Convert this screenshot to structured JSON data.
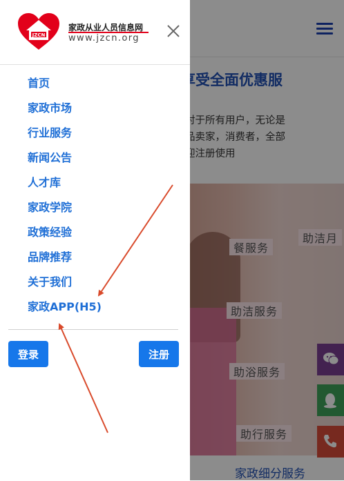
{
  "drawer": {
    "logo_badge": "JZCN",
    "logo_title": "家政从业人员信息网",
    "logo_url": "www.jzcn.org",
    "menu": [
      {
        "label": "首页"
      },
      {
        "label": "家政市场"
      },
      {
        "label": "行业服务"
      },
      {
        "label": "新闻公告"
      },
      {
        "label": "人才库"
      },
      {
        "label": "家政学院"
      },
      {
        "label": "政策经验"
      },
      {
        "label": "品牌推荐"
      },
      {
        "label": "关于我们"
      },
      {
        "label": "家政APP(H5)"
      }
    ],
    "login_label": "登录",
    "register_label": "注册"
  },
  "background": {
    "headline": "享受全面优惠服",
    "paragraph": [
      "对于所有用户，无论是",
      "品卖家，消费者，全部",
      "迎注册使用"
    ],
    "services": [
      "餐服务",
      "助洁月",
      "助洁服务",
      "助浴服务",
      "助行服务"
    ],
    "footer_title": "家政细分服务"
  },
  "colors": {
    "accent": "#1677ea",
    "menu_text": "#1f6fd6",
    "logo_red": "#e2001a",
    "annotation_arrow": "#d94a2b"
  },
  "icons": [
    "heart-house-logo",
    "close-icon",
    "hamburger-menu-icon",
    "wechat-icon",
    "qq-icon",
    "phone-icon"
  ]
}
